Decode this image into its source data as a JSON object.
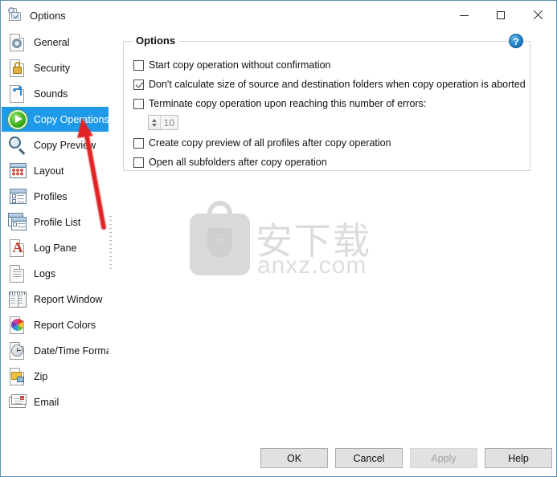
{
  "window": {
    "title": "Options",
    "icon": "options-window-icon",
    "minimize": "—",
    "maximize": "□",
    "close": "✕"
  },
  "sidebar": {
    "items": [
      {
        "label": "General",
        "icon": "general-icon",
        "selected": false
      },
      {
        "label": "Security",
        "icon": "lock-icon",
        "selected": false
      },
      {
        "label": "Sounds",
        "icon": "music-note-icon",
        "selected": false
      },
      {
        "label": "Copy Operations",
        "icon": "green-play-icon",
        "selected": true
      },
      {
        "label": "Copy Preview",
        "icon": "magnifier-icon",
        "selected": false
      },
      {
        "label": "Layout",
        "icon": "layout-window-icon",
        "selected": false
      },
      {
        "label": "Profiles",
        "icon": "profiles-icon",
        "selected": false
      },
      {
        "label": "Profile List",
        "icon": "profile-list-icon",
        "selected": false
      },
      {
        "label": "Log Pane",
        "icon": "letter-a-icon",
        "selected": false
      },
      {
        "label": "Logs",
        "icon": "text-lines-icon",
        "selected": false
      },
      {
        "label": "Report Window",
        "icon": "report-window-icon",
        "selected": false
      },
      {
        "label": "Report Colors",
        "icon": "color-wheel-icon",
        "selected": false
      },
      {
        "label": "Date/Time Format",
        "icon": "clock-icon",
        "selected": false
      },
      {
        "label": "Zip",
        "icon": "zip-folder-icon",
        "selected": false
      },
      {
        "label": "Email",
        "icon": "envelope-icon",
        "selected": false
      }
    ]
  },
  "main": {
    "group_title": "Options",
    "help_badge": "?",
    "checkboxes": [
      {
        "label": "Start copy operation without confirmation",
        "checked": false
      },
      {
        "label": "Don't calculate size of source and destination folders when copy operation is aborted",
        "checked": true
      },
      {
        "label": "Terminate copy operation upon reaching this number of errors:",
        "checked": false
      },
      {
        "label": "Create copy preview of all profiles after copy operation",
        "checked": false
      },
      {
        "label": "Open all subfolders after copy operation",
        "checked": false
      }
    ],
    "error_count_spinner": {
      "value": "10",
      "up": "spin-up",
      "down": "spin-down"
    }
  },
  "watermark": {
    "chinese": "安下载",
    "badge_char": "安",
    "url": "anxz.com"
  },
  "annotation": {
    "arrow_color": "#e02020",
    "points_to": "Copy Operations"
  },
  "footer": {
    "ok": "OK",
    "cancel": "Cancel",
    "apply": "Apply",
    "help": "Help"
  },
  "colors": {
    "selection_blue": "#1f9ae8",
    "window_border": "#5b8fb0",
    "button_face": "#e1e1e1",
    "help_blue": "#1c7fc4",
    "arrow_red": "#e02020"
  }
}
